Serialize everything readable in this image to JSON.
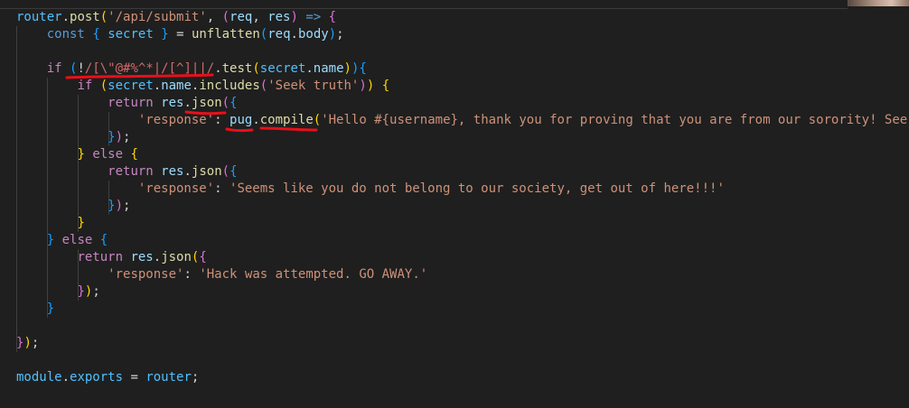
{
  "editor": {
    "colors": {
      "background": "#1f1f1f",
      "keyword": "#c586c0",
      "storage": "#569cd6",
      "variable": "#9cdcfe",
      "constant": "#4fc1ff",
      "function": "#dcdcaa",
      "string": "#ce9178",
      "regex": "#d16969",
      "plain": "#d4d4d4",
      "bracket1": "#ffd700",
      "bracket2": "#da70d6",
      "bracket3": "#179fff",
      "annotation": "#e8101a"
    },
    "lines": [
      [
        {
          "t": "router",
          "c": "constant"
        },
        {
          "t": ".",
          "c": "plain"
        },
        {
          "t": "post",
          "c": "function"
        },
        {
          "t": "(",
          "c": "bracket1"
        },
        {
          "t": "'/api/submit'",
          "c": "string"
        },
        {
          "t": ", ",
          "c": "plain"
        },
        {
          "t": "(",
          "c": "bracket2"
        },
        {
          "t": "req",
          "c": "variable"
        },
        {
          "t": ", ",
          "c": "plain"
        },
        {
          "t": "res",
          "c": "variable"
        },
        {
          "t": ")",
          "c": "bracket2"
        },
        {
          "t": " ",
          "c": "plain"
        },
        {
          "t": "=>",
          "c": "storage"
        },
        {
          "t": " ",
          "c": "plain"
        },
        {
          "t": "{",
          "c": "bracket2"
        }
      ],
      [
        {
          "t": "    ",
          "c": "plain"
        },
        {
          "t": "const",
          "c": "storage"
        },
        {
          "t": " ",
          "c": "plain"
        },
        {
          "t": "{",
          "c": "bracket3"
        },
        {
          "t": " ",
          "c": "plain"
        },
        {
          "t": "secret",
          "c": "constant"
        },
        {
          "t": " ",
          "c": "plain"
        },
        {
          "t": "}",
          "c": "bracket3"
        },
        {
          "t": " = ",
          "c": "plain"
        },
        {
          "t": "unflatten",
          "c": "function"
        },
        {
          "t": "(",
          "c": "bracket3"
        },
        {
          "t": "req",
          "c": "variable"
        },
        {
          "t": ".",
          "c": "plain"
        },
        {
          "t": "body",
          "c": "variable"
        },
        {
          "t": ")",
          "c": "bracket3"
        },
        {
          "t": ";",
          "c": "plain"
        }
      ],
      [],
      [
        {
          "t": "    ",
          "c": "plain"
        },
        {
          "t": "if",
          "c": "keyword"
        },
        {
          "t": " ",
          "c": "plain"
        },
        {
          "t": "(",
          "c": "bracket3"
        },
        {
          "t": "!",
          "c": "plain"
        },
        {
          "t": "/[\\\"@#%^*|/[^]||/",
          "c": "regex"
        },
        {
          "t": ".",
          "c": "plain"
        },
        {
          "t": "test",
          "c": "function"
        },
        {
          "t": "(",
          "c": "bracket1"
        },
        {
          "t": "secret",
          "c": "constant"
        },
        {
          "t": ".",
          "c": "plain"
        },
        {
          "t": "name",
          "c": "variable"
        },
        {
          "t": ")",
          "c": "bracket1"
        },
        {
          "t": ")",
          "c": "bracket3"
        },
        {
          "t": "{",
          "c": "bracket3"
        }
      ],
      [
        {
          "t": "        ",
          "c": "plain"
        },
        {
          "t": "if",
          "c": "keyword"
        },
        {
          "t": " ",
          "c": "plain"
        },
        {
          "t": "(",
          "c": "bracket1"
        },
        {
          "t": "secret",
          "c": "constant"
        },
        {
          "t": ".",
          "c": "plain"
        },
        {
          "t": "name",
          "c": "variable"
        },
        {
          "t": ".",
          "c": "plain"
        },
        {
          "t": "includes",
          "c": "function"
        },
        {
          "t": "(",
          "c": "bracket2"
        },
        {
          "t": "'Seek truth'",
          "c": "string"
        },
        {
          "t": ")",
          "c": "bracket2"
        },
        {
          "t": ")",
          "c": "bracket1"
        },
        {
          "t": " ",
          "c": "plain"
        },
        {
          "t": "{",
          "c": "bracket1"
        }
      ],
      [
        {
          "t": "            ",
          "c": "plain"
        },
        {
          "t": "return",
          "c": "keyword"
        },
        {
          "t": " ",
          "c": "plain"
        },
        {
          "t": "res",
          "c": "variable"
        },
        {
          "t": ".",
          "c": "plain"
        },
        {
          "t": "json",
          "c": "function"
        },
        {
          "t": "(",
          "c": "bracket2"
        },
        {
          "t": "{",
          "c": "bracket3"
        }
      ],
      [
        {
          "t": "                ",
          "c": "plain"
        },
        {
          "t": "'response'",
          "c": "string"
        },
        {
          "t": ": ",
          "c": "plain"
        },
        {
          "t": "pug",
          "c": "variable"
        },
        {
          "t": ".",
          "c": "plain"
        },
        {
          "t": "compile",
          "c": "function"
        },
        {
          "t": "(",
          "c": "bracket1"
        },
        {
          "t": "'Hello #{username}, thank you for proving that you are from our sorority! See",
          "c": "string"
        }
      ],
      [
        {
          "t": "            ",
          "c": "plain"
        },
        {
          "t": "}",
          "c": "bracket3"
        },
        {
          "t": ")",
          "c": "bracket2"
        },
        {
          "t": ";",
          "c": "plain"
        }
      ],
      [
        {
          "t": "        ",
          "c": "plain"
        },
        {
          "t": "}",
          "c": "bracket1"
        },
        {
          "t": " ",
          "c": "plain"
        },
        {
          "t": "else",
          "c": "keyword"
        },
        {
          "t": " ",
          "c": "plain"
        },
        {
          "t": "{",
          "c": "bracket1"
        }
      ],
      [
        {
          "t": "            ",
          "c": "plain"
        },
        {
          "t": "return",
          "c": "keyword"
        },
        {
          "t": " ",
          "c": "plain"
        },
        {
          "t": "res",
          "c": "variable"
        },
        {
          "t": ".",
          "c": "plain"
        },
        {
          "t": "json",
          "c": "function"
        },
        {
          "t": "(",
          "c": "bracket2"
        },
        {
          "t": "{",
          "c": "bracket3"
        }
      ],
      [
        {
          "t": "                ",
          "c": "plain"
        },
        {
          "t": "'response'",
          "c": "string"
        },
        {
          "t": ": ",
          "c": "plain"
        },
        {
          "t": "'Seems like you do not belong to our society, get out of here!!!'",
          "c": "string"
        }
      ],
      [
        {
          "t": "            ",
          "c": "plain"
        },
        {
          "t": "}",
          "c": "bracket3"
        },
        {
          "t": ")",
          "c": "bracket2"
        },
        {
          "t": ";",
          "c": "plain"
        }
      ],
      [
        {
          "t": "        ",
          "c": "plain"
        },
        {
          "t": "}",
          "c": "bracket1"
        }
      ],
      [
        {
          "t": "    ",
          "c": "plain"
        },
        {
          "t": "}",
          "c": "bracket3"
        },
        {
          "t": " ",
          "c": "plain"
        },
        {
          "t": "else",
          "c": "keyword"
        },
        {
          "t": " ",
          "c": "plain"
        },
        {
          "t": "{",
          "c": "bracket3"
        }
      ],
      [
        {
          "t": "        ",
          "c": "plain"
        },
        {
          "t": "return",
          "c": "keyword"
        },
        {
          "t": " ",
          "c": "plain"
        },
        {
          "t": "res",
          "c": "variable"
        },
        {
          "t": ".",
          "c": "plain"
        },
        {
          "t": "json",
          "c": "function"
        },
        {
          "t": "(",
          "c": "bracket1"
        },
        {
          "t": "{",
          "c": "bracket2"
        }
      ],
      [
        {
          "t": "            ",
          "c": "plain"
        },
        {
          "t": "'response'",
          "c": "string"
        },
        {
          "t": ": ",
          "c": "plain"
        },
        {
          "t": "'Hack was attempted. GO AWAY.'",
          "c": "string"
        }
      ],
      [
        {
          "t": "        ",
          "c": "plain"
        },
        {
          "t": "}",
          "c": "bracket2"
        },
        {
          "t": ")",
          "c": "bracket1"
        },
        {
          "t": ";",
          "c": "plain"
        }
      ],
      [
        {
          "t": "    ",
          "c": "plain"
        },
        {
          "t": "}",
          "c": "bracket3"
        }
      ],
      [],
      [
        {
          "t": "}",
          "c": "bracket2"
        },
        {
          "t": ")",
          "c": "bracket1"
        },
        {
          "t": ";",
          "c": "plain"
        }
      ],
      [],
      [
        {
          "t": "module",
          "c": "constant"
        },
        {
          "t": ".",
          "c": "plain"
        },
        {
          "t": "exports",
          "c": "constant"
        },
        {
          "t": " = ",
          "c": "plain"
        },
        {
          "t": "router",
          "c": "constant"
        },
        {
          "t": ";",
          "c": "plain"
        }
      ]
    ]
  }
}
